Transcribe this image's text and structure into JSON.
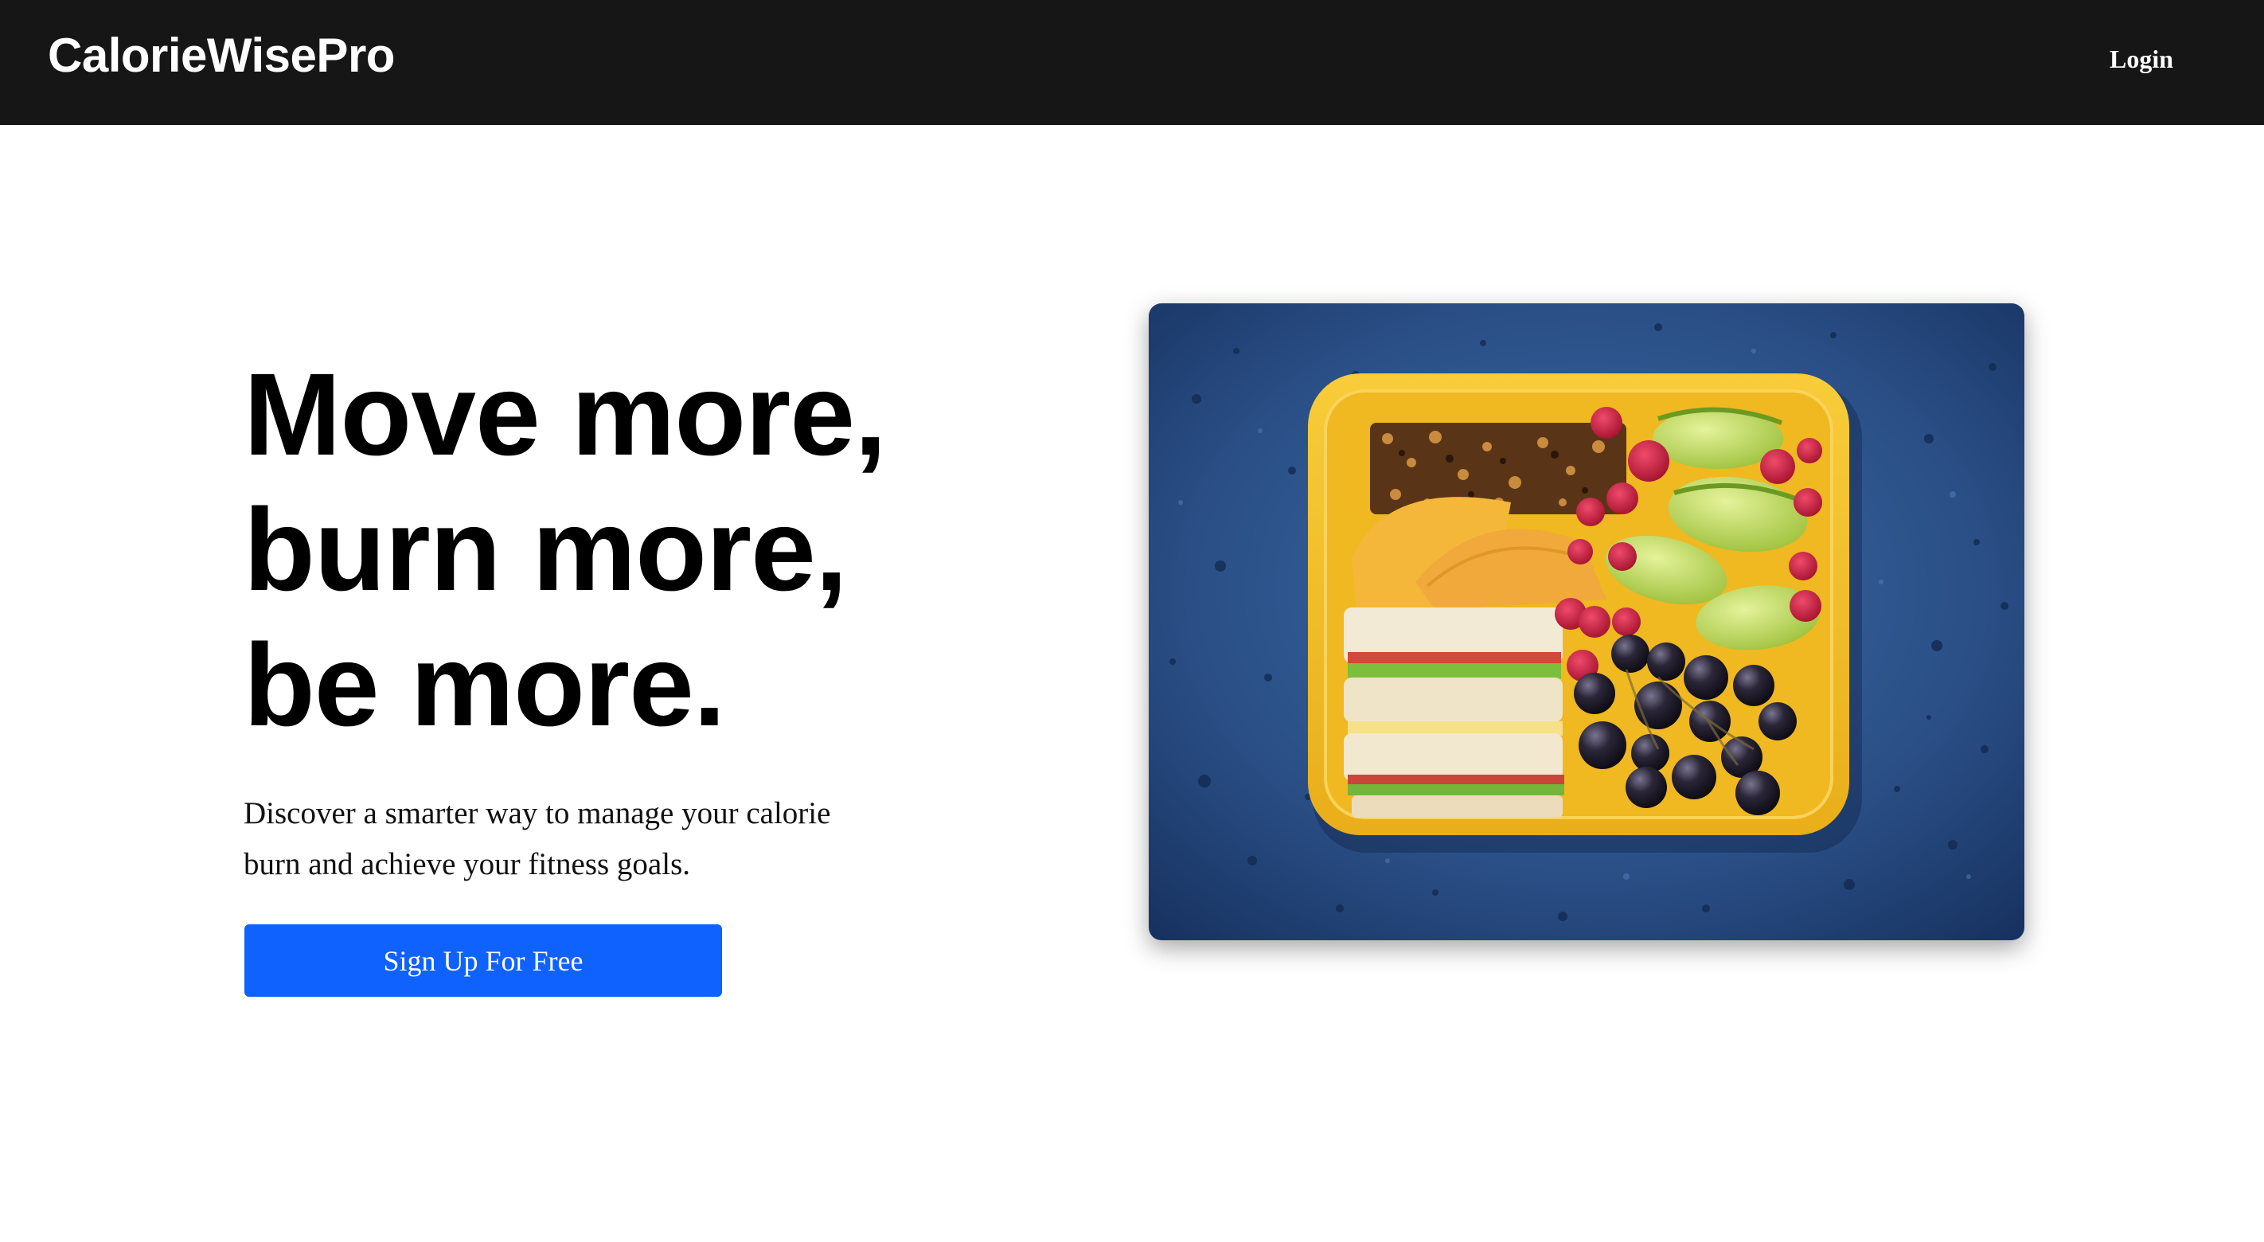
{
  "navbar": {
    "brand": "CalorieWisePro",
    "login_label": "Login"
  },
  "hero": {
    "headline_lines": [
      "Move more,",
      "burn more,",
      "be more."
    ],
    "subtitle": "Discover a smarter way to manage your calorie burn and achieve your fitness goals.",
    "cta_label": "Sign Up For Free"
  },
  "colors": {
    "navbar_bg": "#161616",
    "cta_bg": "#0f62fe",
    "image_bg": "#2a4f86",
    "lunchbox": "#f5c22a"
  },
  "image": {
    "subject": "lunchbox-with-sandwich-fruit-granola-image"
  }
}
